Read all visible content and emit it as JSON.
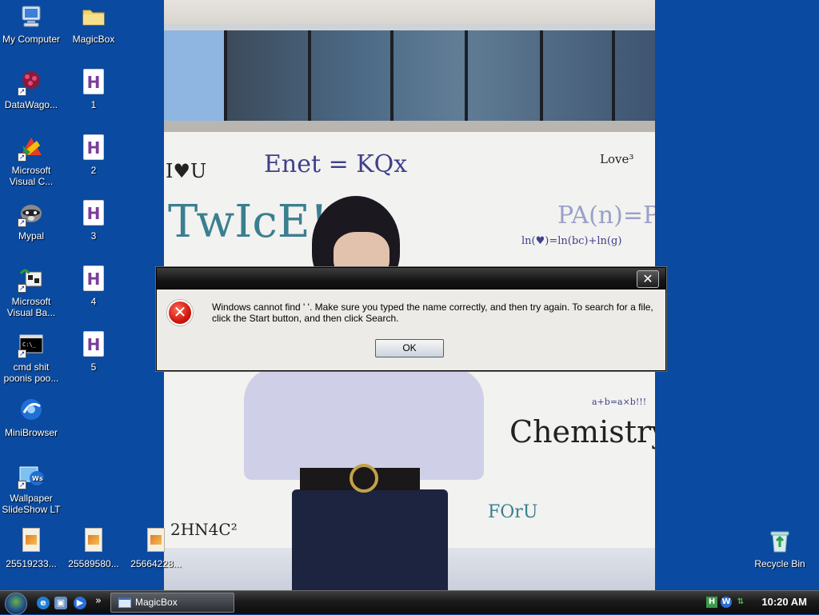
{
  "desktop": {
    "icons": [
      {
        "label": "My Computer"
      },
      {
        "label": "MagicBox"
      },
      {
        "label": "DataWago..."
      },
      {
        "label": "1"
      },
      {
        "label": "Microsoft\nVisual C..."
      },
      {
        "label": "2"
      },
      {
        "label": "Mypal"
      },
      {
        "label": "3"
      },
      {
        "label": "Microsoft\nVisual Ba..."
      },
      {
        "label": "4"
      },
      {
        "label": "cmd shit\npoonis poo..."
      },
      {
        "label": "5"
      },
      {
        "label": "MiniBrowser"
      },
      {
        "label": "Wallpaper\nSlideShow LT"
      },
      {
        "label": "25519233..."
      },
      {
        "label": "25589580..."
      },
      {
        "label": "25664228..."
      },
      {
        "label": "Recycle Bin"
      }
    ]
  },
  "wallpaper": {
    "texts": [
      "Enet = KQx",
      "TwIcE!",
      "Chemistry",
      "FOrU",
      "ln(♥)=ln(bc)+ln(g)",
      "PA(n)=PB",
      "a+b=a×b!!!",
      "I♥U",
      "Love³",
      "2HN4C²"
    ]
  },
  "dialog": {
    "message": "Windows cannot find '   '. Make sure you typed the name correctly, and then try again. To search for a file, click the Start button, and then click Search.",
    "ok_label": "OK",
    "close_glyph": "✕",
    "error_glyph": "✕"
  },
  "taskbar": {
    "task_label": "MagicBox",
    "chevron": "»",
    "clock": "10:20 AM"
  },
  "colors": {
    "desktop_bg": "#0a4aa0",
    "dialog_bg": "#ecebe7",
    "error_red": "#d0170c"
  }
}
